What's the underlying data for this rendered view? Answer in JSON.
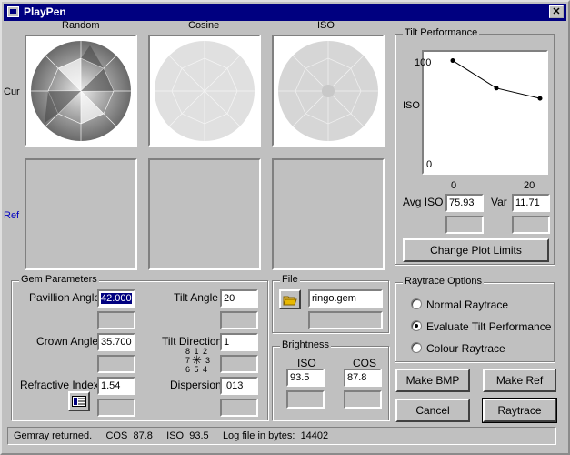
{
  "window": {
    "title": "PlayPen",
    "close_glyph": "✕"
  },
  "columns": {
    "random": "Random",
    "cosine": "Cosine",
    "iso": "ISO"
  },
  "rows": {
    "cur": "Cur",
    "ref": "Ref"
  },
  "tilt": {
    "legend": "Tilt Performance",
    "chart_data": {
      "type": "line",
      "x": [
        0,
        10,
        20
      ],
      "series": [
        {
          "values": [
            94,
            70,
            61
          ]
        }
      ],
      "ylabel": "ISO",
      "ytick_labels": [
        "100",
        "0"
      ],
      "xtick_labels": [
        "0",
        "20"
      ],
      "ylim": [
        0,
        100
      ],
      "xlim": [
        0,
        20
      ]
    },
    "avg_iso_label": "Avg ISO",
    "avg_iso_value": "75.93",
    "var_label": "Var",
    "var_value": "11.71",
    "change_limits_button": "Change Plot Limits"
  },
  "gem": {
    "legend": "Gem Parameters",
    "pavilion_angle_label": "Pavillion Angle",
    "pavilion_angle_value": "42.000",
    "tilt_angle_label": "Tilt Angle",
    "tilt_angle_value": "20",
    "crown_angle_label": "Crown Angle",
    "crown_angle_value": "35.700",
    "tilt_direction_label": "Tilt Direction",
    "tilt_direction_value": "1",
    "compass_row1": "8 1 2",
    "compass_row2a": "7",
    "compass_row2b": "3",
    "compass_row3": "6 5 4",
    "refractive_index_label": "Refractive Index",
    "refractive_index_value": "1.54",
    "dispersion_label": "Dispersion",
    "dispersion_value": ".013"
  },
  "file": {
    "legend": "File",
    "filename": "ringo.gem"
  },
  "brightness": {
    "legend": "Brightness",
    "iso_label": "ISO",
    "cos_label": "COS",
    "iso_value": "93.5",
    "cos_value": "87.8"
  },
  "raytrace_options": {
    "legend": "Raytrace Options",
    "normal": "Normal Raytrace",
    "evaluate": "Evaluate Tilt Performance",
    "colour": "Colour Raytrace",
    "selected": "evaluate"
  },
  "buttons": {
    "make_bmp": "Make BMP",
    "make_ref": "Make Ref",
    "cancel": "Cancel",
    "raytrace": "Raytrace"
  },
  "status": {
    "gemray": "Gemray returned.",
    "cos_label": "COS",
    "cos_value": "87.8",
    "iso_label": "ISO",
    "iso_value": "93.5",
    "log_label": "Log file in bytes:",
    "log_value": "14402"
  }
}
